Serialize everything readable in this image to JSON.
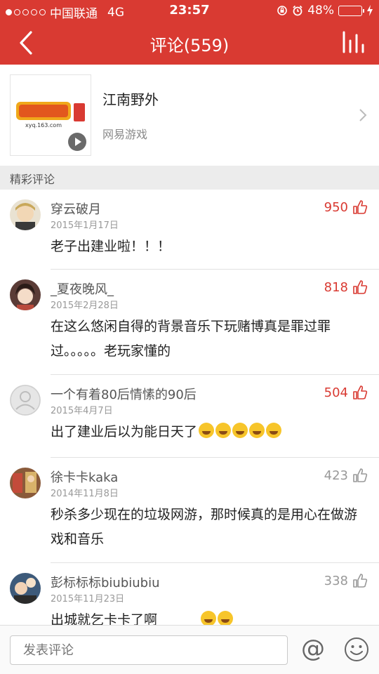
{
  "status": {
    "carrier": "中国联通",
    "network": "4G",
    "time": "23:57",
    "battery": "48%",
    "battery_level": 0.48
  },
  "nav": {
    "title": "评论(559)"
  },
  "game": {
    "name": "江南野外",
    "maker": "网易游戏"
  },
  "section": {
    "title": "精彩评论"
  },
  "comments": [
    {
      "user": "穿云破月",
      "date": "2015年1月17日",
      "likes": "950",
      "text": "老子出建业啦！！！"
    },
    {
      "user": "_夏夜晚风_",
      "date": "2015年2月28日",
      "likes": "818",
      "text": "在这么悠闲自得的背景音乐下玩赌博真是罪过罪过。。。。。老玩家懂的"
    },
    {
      "user": "一个有着80后情愫的90后",
      "date": "2015年4月7日",
      "likes": "504",
      "text": "出了建业后以为能日天了"
    },
    {
      "user": "徐卡卡kaka",
      "date": "2014年11月8日",
      "likes": "423",
      "text": "秒杀多少现在的垃圾网游，那时候真的是用心在做游戏和音乐"
    },
    {
      "user": "彭标标标biubiubiu",
      "date": "2015年11月23日",
      "likes": "338",
      "text": "出城就乞卡卡了啊"
    }
  ],
  "bottom": {
    "placeholder": "发表评论"
  },
  "colors": {
    "brand": "#d93a32",
    "like_active": "#d93a32"
  }
}
